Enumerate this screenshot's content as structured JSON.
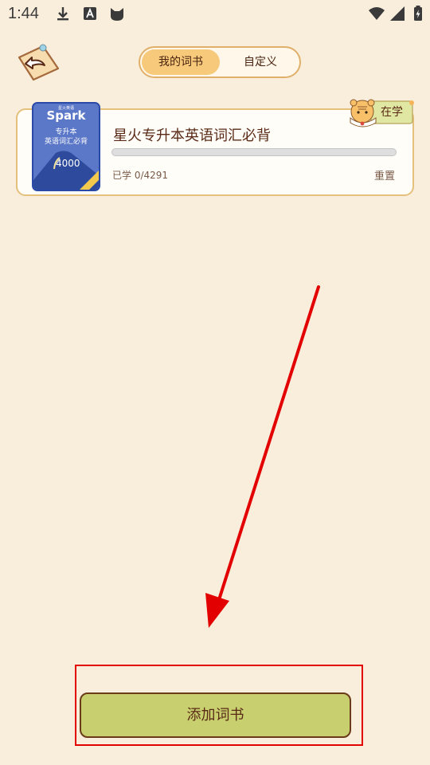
{
  "status_bar": {
    "time": "1:44"
  },
  "tabs": [
    {
      "label": "我的词书",
      "active": true
    },
    {
      "label": "自定义",
      "active": false
    }
  ],
  "book": {
    "title": "星火专升本英语词汇必背",
    "badge": "在学",
    "learned_text": "已学 0/4291",
    "progress_fraction": 0,
    "reset_label": "重置",
    "cover": {
      "brand_small": "星火英语",
      "brand": "Spark",
      "line1": "专升本",
      "line2": "英语词汇必背",
      "number": "4000"
    }
  },
  "add_button": {
    "label": "添加词书"
  },
  "colors": {
    "background": "#f9eedc",
    "accent": "#f7c97a",
    "button": "#c7cf6e",
    "annotation": "#e30000"
  }
}
